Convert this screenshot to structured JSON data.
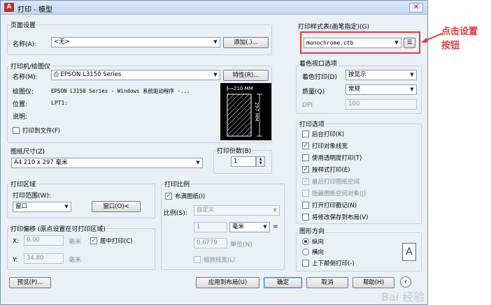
{
  "window": {
    "title": "打印 - 模型",
    "close_glyph": "✕",
    "app_icon_letter": "A"
  },
  "page_setup": {
    "group_title": "页面设置",
    "name_label": "名称(A):",
    "name_value": "<无>",
    "add_button": "添加(.)..."
  },
  "printer": {
    "group_title": "打印机/绘图仪",
    "name_label": "名称(M):",
    "name_value": "EPSON L3150 Series",
    "properties_button": "特性(R)...",
    "plotter_label": "绘图仪:",
    "plotter_value": "EPSON L3150 Series - Windows 系统驱动程序 -...",
    "location_label": "位置:",
    "location_value": "LPT1:",
    "description_label": "说明:",
    "print_to_file_label": "打印到文件(F)",
    "print_to_file_checked": false,
    "preview_width_label": "210 MM",
    "preview_height_label": "297 MM"
  },
  "paper_size": {
    "group_title": "图纸尺寸(Z)",
    "value": "A4 210 x 297 毫米"
  },
  "copies": {
    "label": "打印份数(B)",
    "value": "1"
  },
  "print_area": {
    "group_title": "打印区域",
    "range_label": "打印范围(W):",
    "range_value": "窗口",
    "window_button": "窗口(O)<"
  },
  "print_offset": {
    "group_title": "打印偏移 (原点设置在可打印区域)",
    "x_label": "X:",
    "x_value": "0.00",
    "x_unit": "毫米",
    "y_label": "Y:",
    "y_value": "34.80",
    "y_unit": "毫米",
    "center_label": "居中打印(C)",
    "center_checked": true
  },
  "print_scale": {
    "group_title": "打印比例",
    "fit_label": "布满图纸(I)",
    "fit_checked": true,
    "scale_label": "比例(S):",
    "scale_value": "自定义",
    "value1": "1",
    "unit_value": "毫米",
    "equals": "=",
    "value2": "0.6779",
    "unit2_label": "单位(N)",
    "lineweights_label": "缩放线宽(L)",
    "lineweights_checked": false
  },
  "plot_style": {
    "group_title": "打印样式表(画笔指定)(G)",
    "value": "monochrome.ctb"
  },
  "shaded_viewport": {
    "group_title": "着色视口选项",
    "shade_label": "着色打印(D)",
    "shade_value": "按显示",
    "quality_label": "质量(Q)",
    "quality_value": "常规",
    "dpi_label": "DPI",
    "dpi_value": "100"
  },
  "plot_options": {
    "group_title": "打印选项",
    "items": [
      {
        "label": "后台打印(K)",
        "checked": false,
        "disabled": false
      },
      {
        "label": "打印对象线宽",
        "checked": true,
        "disabled": false
      },
      {
        "label": "使用透明度打印(T)",
        "checked": false,
        "disabled": false
      },
      {
        "label": "按样式打印(E)",
        "checked": true,
        "disabled": false
      },
      {
        "label": "最后打印图纸空间",
        "checked": true,
        "disabled": true
      },
      {
        "label": "隐藏图纸空间对象(J)",
        "checked": false,
        "disabled": true
      },
      {
        "label": "打开打印戳记(N)",
        "checked": false,
        "disabled": false
      },
      {
        "label": "将修改保存到布局(V)",
        "checked": false,
        "disabled": false
      }
    ]
  },
  "orientation": {
    "group_title": "图形方向",
    "portrait_label": "纵向",
    "portrait_selected": true,
    "landscape_label": "横向",
    "landscape_selected": false,
    "upside_label": "上下颠倒打印(-)",
    "upside_checked": false,
    "icon_letter": "A"
  },
  "footer": {
    "preview_button": "预览(P)...",
    "apply_button": "应用到布局(U)",
    "ok_button": "确定",
    "cancel_button": "取消",
    "help_button": "帮助(H)",
    "collapse_glyph": "‹"
  },
  "annotation": {
    "line1": "点击设置",
    "line2": "按钮",
    "color": "#e53935"
  },
  "watermark": "Bai 经验"
}
